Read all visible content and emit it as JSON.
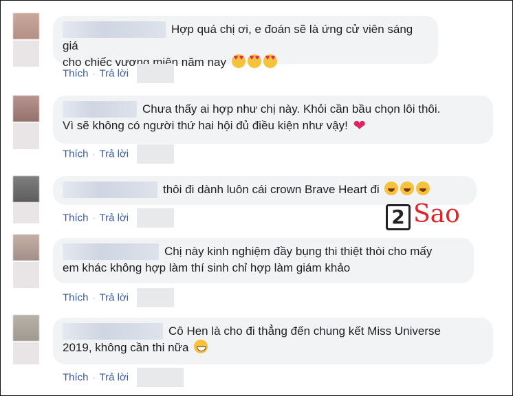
{
  "comments": [
    {
      "text_line1": "Hợp quá chị ơi, e đoán sẽ là ứng cử viên sáng giá",
      "text_line2": "cho chiếc vương miện năm nay",
      "emoji": [
        "heart-eyes-emoji",
        "heart-eyes-emoji",
        "heart-eyes-emoji"
      ],
      "like_label": "Thích",
      "reply_label": "Trả lời"
    },
    {
      "text_line1": "Chưa thấy ai hợp như chị này. Khỏi cần bầu chọn lôi thôi.",
      "text_line2": "Vì sẽ không có người thứ hai hội đủ điều kiện như vậy!",
      "emoji": [
        "red-heart-emoji"
      ],
      "heart_glyph": "❤",
      "like_label": "Thích",
      "reply_label": "Trả lời"
    },
    {
      "text_line1": "thôi đi dành luôn cái crown Brave Heart đi",
      "emoji": [
        "rolling-laugh-emoji",
        "rolling-laugh-emoji",
        "rolling-laugh-emoji"
      ],
      "like_label": "Thích",
      "reply_label": "Trả lời"
    },
    {
      "text_line1": "Chị này kinh nghiệm đầy bụng thi thiệt thòi cho mấy",
      "text_line2": "em khác không hợp làm thí sinh chỉ hợp làm giám khảo",
      "like_label": "Thích",
      "reply_label": "Trả lời"
    },
    {
      "text_line1": "Cô Hen là cho đi thẳng đến chung kết Miss Universe",
      "text_line2": "2019, không cần thi nữa",
      "emoji": [
        "grinning-emoji"
      ],
      "like_label": "Thích",
      "reply_label": "Trả lời"
    }
  ],
  "separator": "·",
  "watermark": {
    "number": "2",
    "brand": "Sao",
    "color": "#e0242a"
  },
  "colors": {
    "bubble_bg": "#f2f3f5",
    "link": "#385898",
    "text": "#1c1e21"
  }
}
